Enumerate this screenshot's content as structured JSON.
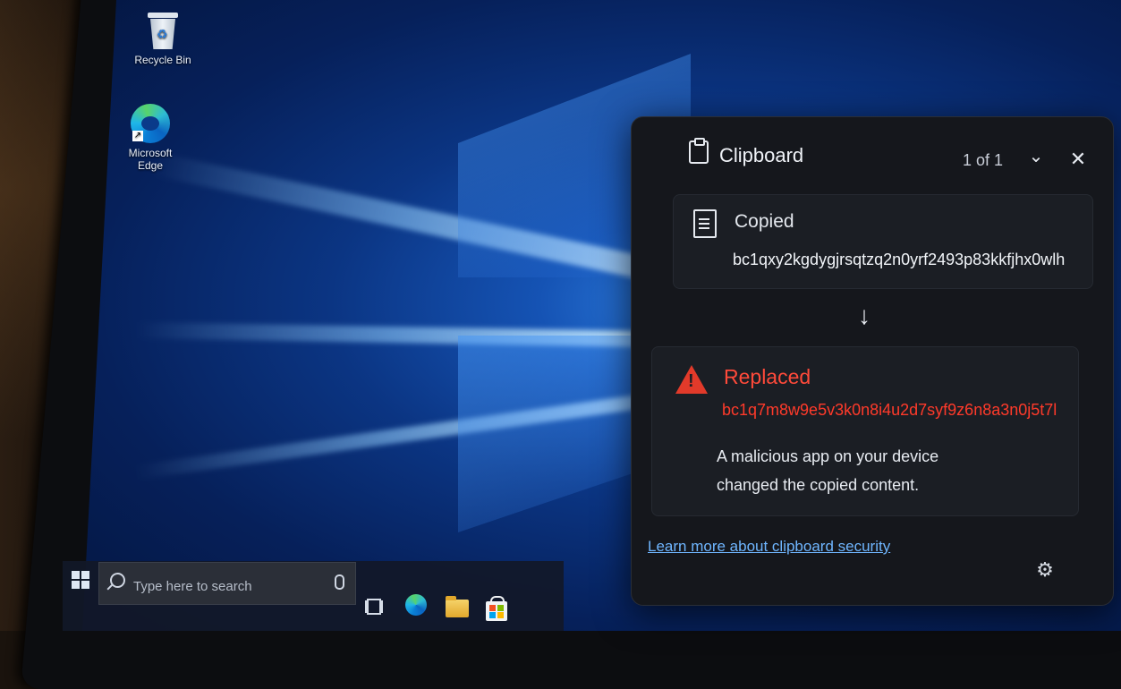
{
  "desktop": {
    "icons": [
      {
        "label": "Recycle Bin"
      },
      {
        "label": "Microsoft Edge"
      }
    ]
  },
  "taskbar": {
    "search_placeholder": "Type here to search"
  },
  "clipboard": {
    "title": "Clipboard",
    "counter": "1 of 1",
    "copied": {
      "label": "Copied",
      "value": "bc1qxy2kgdygjrsqtzq2n0yrf2493p83kkfjhx0wlh"
    },
    "replaced": {
      "label": "Replaced",
      "value": "bc1q7m8w9e5v3k0n8i4u2d7syf9z6n8a3n0j5t7l",
      "warning_line1": "A malicious app on your device",
      "warning_line2": "changed the copied content."
    },
    "learn_more": "Learn more about clipboard security"
  },
  "colors": {
    "panel_bg": "#15171c",
    "warning_red": "#ff3a2a",
    "link_blue": "#6fb6ff",
    "desktop_blue": "#1553b4"
  }
}
